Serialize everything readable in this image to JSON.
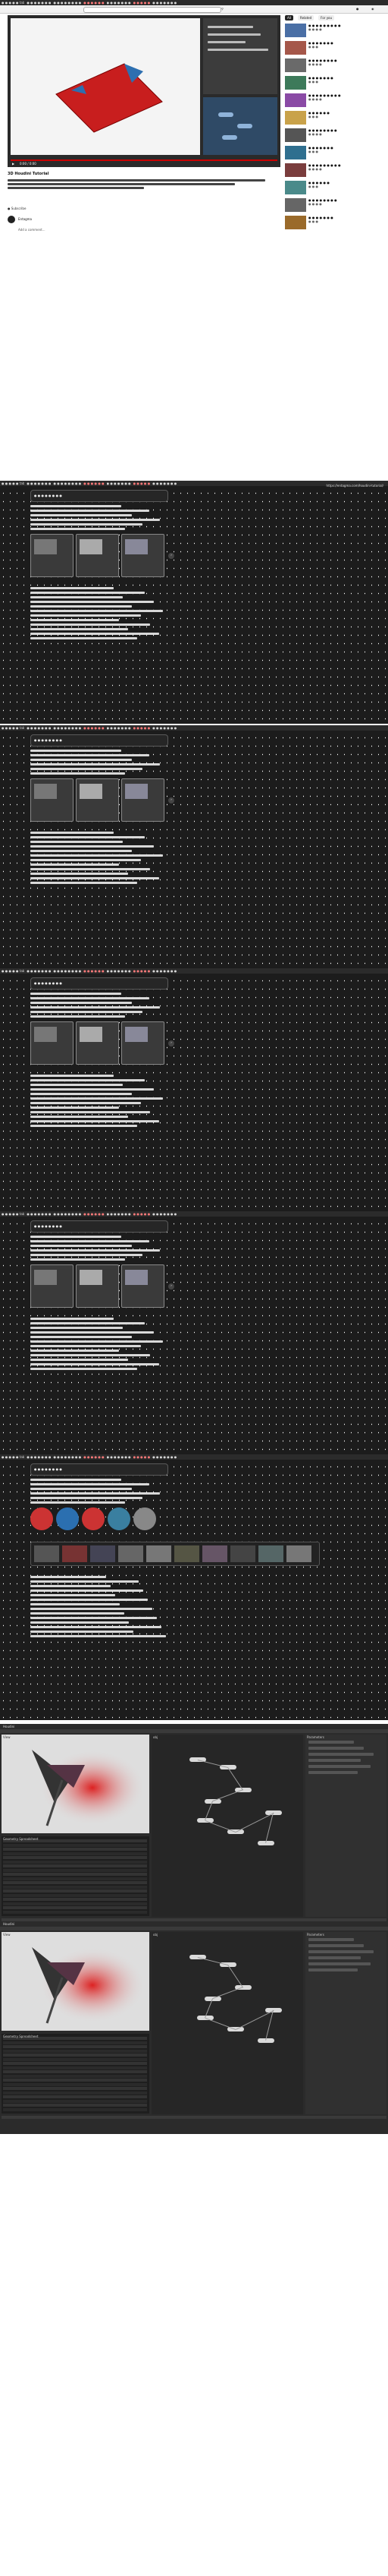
{
  "browser": {
    "tabs": [
      {
        "label": "● ● ● ● ●  tab",
        "red": false
      },
      {
        "label": "● ● ● ● ● ● ●",
        "red": false
      },
      {
        "label": "● ● ● ● ● ● ● ●",
        "red": false
      },
      {
        "label": "● ● ● ● ● ●",
        "red": true
      },
      {
        "label": "● ● ● ● ● ● ●",
        "red": false
      },
      {
        "label": "● ● ● ● ●",
        "red": true
      },
      {
        "label": "● ● ● ● ● ● ●",
        "red": false
      }
    ]
  },
  "video_page": {
    "player_time": "0:00 / 0:00",
    "video_title": "3D Houdini Tutorial",
    "description_lines": [
      "● ● ● ● ● ● ● ● ● ● ● ● ● ● ● ● ● ● ● ● ● ● ● ● ● ● ● ● ● ● ● ● ● ● ●",
      "● ● ● ● ● ● ● ● ● ● ● ● ● ● ● ● ●"
    ],
    "subscribe_label": "● Subscribe",
    "channel_name": "Entagma",
    "comment_label": "Add a comment...",
    "sidebar_tabs": [
      "All",
      "Related",
      "For you"
    ],
    "sidebar_items": [
      {
        "title": "● ● ● ● ● ● ● ● ●",
        "meta": "● ● ● ●"
      },
      {
        "title": "● ● ● ● ● ● ●",
        "meta": "● ● ●"
      },
      {
        "title": "● ● ● ● ● ● ● ●",
        "meta": "● ● ● ●"
      },
      {
        "title": "● ● ● ● ● ● ●",
        "meta": "● ● ●"
      },
      {
        "title": "● ● ● ● ● ● ● ● ●",
        "meta": "● ● ● ●"
      },
      {
        "title": "● ● ● ● ● ●",
        "meta": "● ● ●"
      },
      {
        "title": "● ● ● ● ● ● ● ●",
        "meta": "● ● ● ●"
      },
      {
        "title": "● ● ● ● ● ● ●",
        "meta": "● ● ●"
      },
      {
        "title": "● ● ● ● ● ● ● ● ●",
        "meta": "● ● ● ●"
      },
      {
        "title": "● ● ● ● ● ●",
        "meta": "● ● ●"
      },
      {
        "title": "● ● ● ● ● ● ● ●",
        "meta": "● ● ● ●"
      },
      {
        "title": "● ● ● ● ● ● ●",
        "meta": "● ● ●"
      }
    ]
  },
  "tutorial_sections": [
    {
      "heading": "● ● ● ● ● ● ● ●",
      "url": "https://entagma.com/houdini-tutorial/"
    },
    {
      "heading": "● ● ● ● ● ● ● ●",
      "url": ""
    },
    {
      "heading": "● ● ● ● ● ● ● ●",
      "url": ""
    },
    {
      "heading": "● ● ● ● ● ● ● ●",
      "url": ""
    },
    {
      "heading": "● ● ● ● ● ● ● ●",
      "url": ""
    }
  ],
  "houdini": {
    "app_title": "Houdini",
    "viewport_label": "View",
    "network_label": "obj",
    "param_label": "Parameters",
    "spreadsheet_label": "Geometry Spreadsheet"
  }
}
